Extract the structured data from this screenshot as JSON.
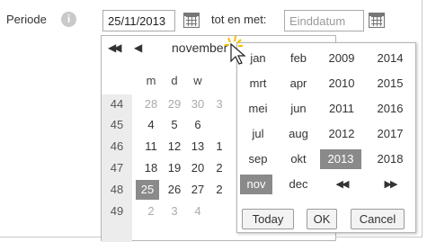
{
  "form": {
    "period_label": "Periode",
    "info_icon_glyph": "i",
    "from_value": "25/11/2013",
    "to_label": "tot en met:",
    "to_placeholder": "Einddatum"
  },
  "day_calendar": {
    "nav_prev_year": "◀◀",
    "nav_prev_month": "◀",
    "month_label": "november",
    "weekdays": [
      "m",
      "d",
      "w",
      "",
      "",
      "",
      ""
    ],
    "weeks": [
      {
        "num": "44",
        "days": [
          "28",
          "29",
          "30",
          "3"
        ]
      },
      {
        "num": "45",
        "days": [
          "4",
          "5",
          "6",
          ""
        ]
      },
      {
        "num": "46",
        "days": [
          "11",
          "12",
          "13",
          "1"
        ]
      },
      {
        "num": "47",
        "days": [
          "18",
          "19",
          "20",
          "2"
        ]
      },
      {
        "num": "48",
        "days": [
          "25",
          "26",
          "27",
          "2"
        ]
      },
      {
        "num": "49",
        "days": [
          "2",
          "3",
          "4",
          ""
        ]
      }
    ],
    "selected_day": "25"
  },
  "month_year_picker": {
    "months": [
      "jan",
      "feb",
      "mrt",
      "apr",
      "mei",
      "jun",
      "jul",
      "aug",
      "sep",
      "okt",
      "nov",
      "dec"
    ],
    "years": [
      "2009",
      "2014",
      "2010",
      "2015",
      "2011",
      "2016",
      "2012",
      "2017",
      "2013",
      "2018"
    ],
    "selected_month": "nov",
    "selected_year": "2013",
    "prev_years": "◀◀",
    "next_years": "▶▶",
    "today_label": "Today",
    "ok_label": "OK",
    "cancel_label": "Cancel"
  },
  "colors": {
    "selected_bg": "#8a8a8a",
    "week_column_bg": "#ececec",
    "cursor_glow": "#f5c000"
  },
  "icons": [
    "info-icon",
    "calendar-icon",
    "arrow-cursor-icon"
  ]
}
